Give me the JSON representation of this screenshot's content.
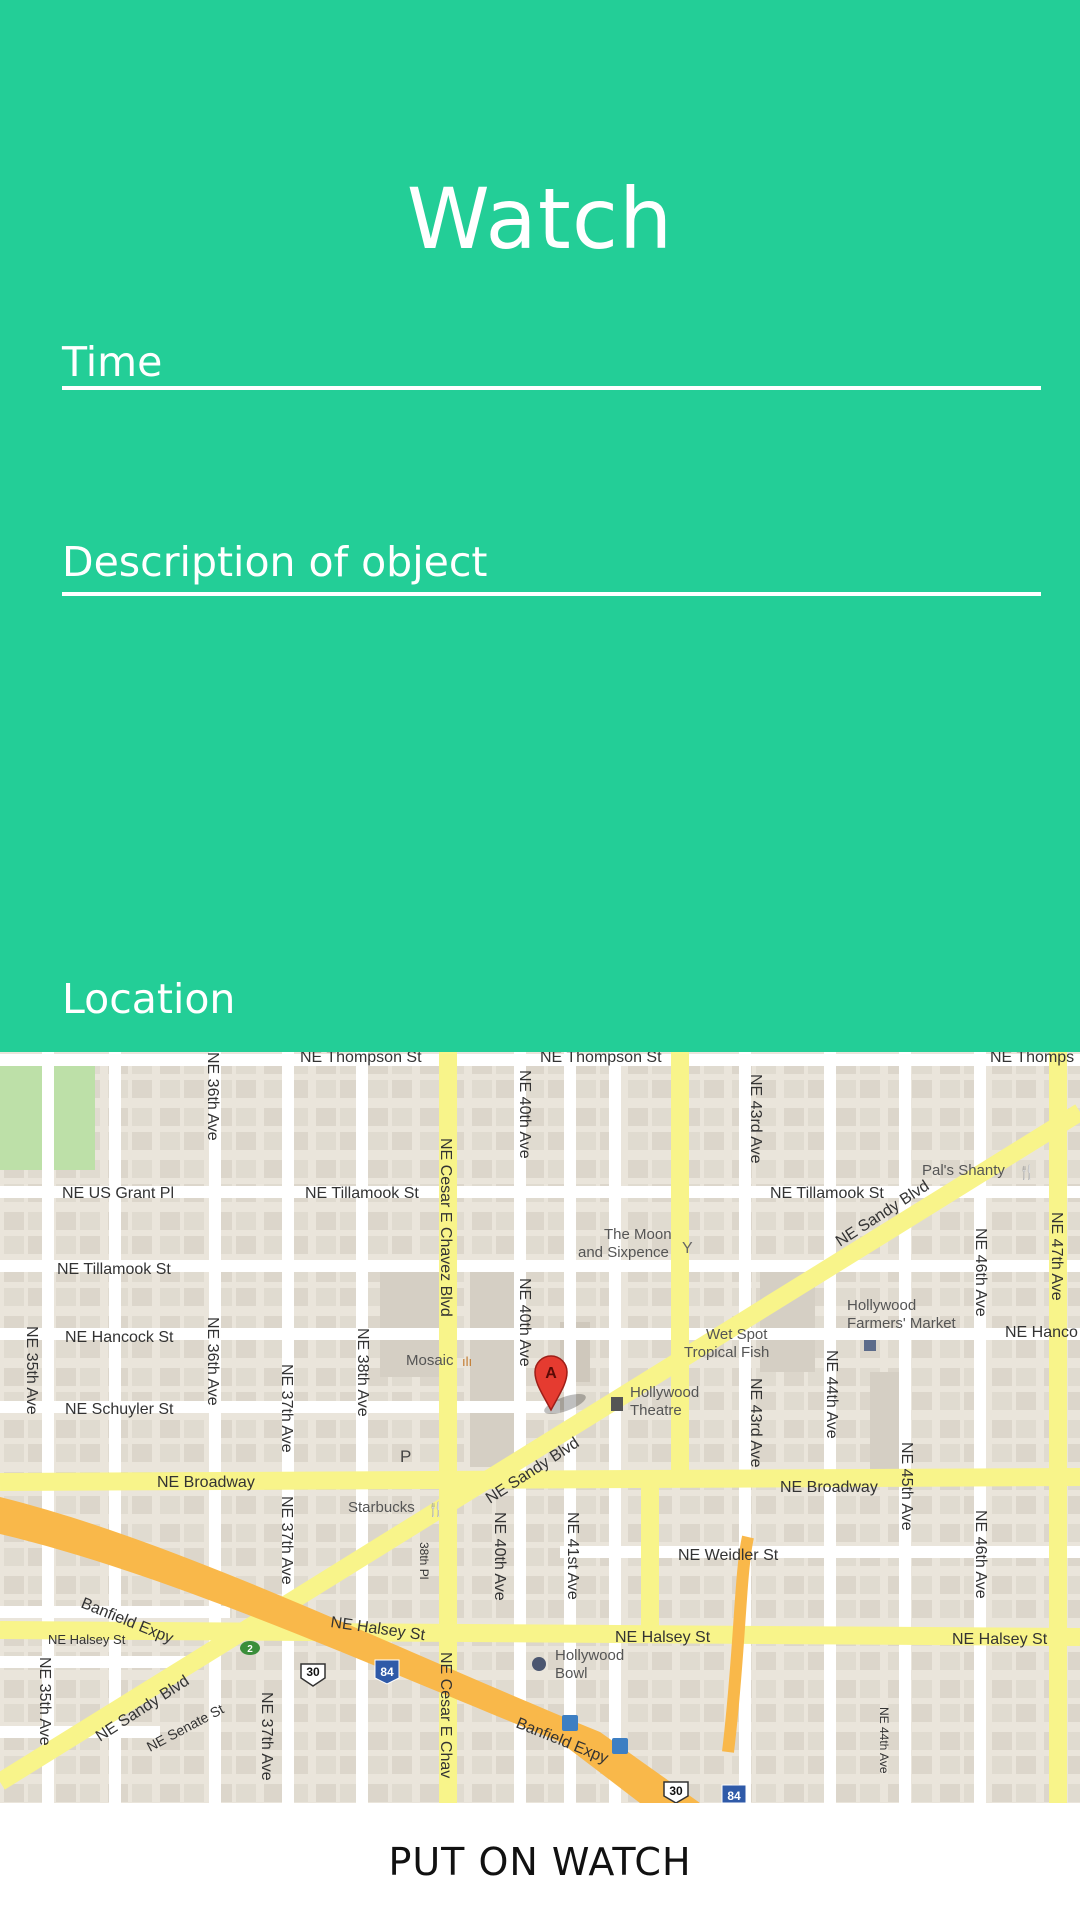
{
  "header": {
    "title": "Watch"
  },
  "fields": {
    "time_label": "Time",
    "description_label": "Description of object",
    "location_label": "Location"
  },
  "map": {
    "streets": {
      "thompson1": "NE Thompson St",
      "thompson2": "NE Thompson St",
      "thompson3": "NE Thomps",
      "us_grant": "NE US Grant Pl",
      "tillamook1": "NE Tillamook St",
      "tillamook2": "NE Tillamook St",
      "tillamook3": "NE Tillamook St",
      "hancock1": "NE Hancock St",
      "hancock2": "NE Hanco",
      "schuyler": "NE Schuyler St",
      "broadway1": "NE Broadway",
      "broadway2": "NE Broadway",
      "weidler": "NE Weidler St",
      "halsey1": "NE Halsey St",
      "halsey2": "NE Halsey St",
      "halsey3": "NE Halsey St",
      "halsey4": "NE Halsey St",
      "senate": "NE Senate St",
      "sandy1": "NE Sandy Blvd",
      "sandy2": "NE Sandy Blvd",
      "sandy3": "NE Sandy Blvd",
      "banfield1": "Banfield Expy",
      "banfield2": "Banfield Expy",
      "ave35a": "NE 35th Ave",
      "ave35b": "NE 35th Ave",
      "ave36a": "NE 36th Ave",
      "ave36b": "NE 36th Ave",
      "ave37a": "NE 37th Ave",
      "ave37b": "NE 37th Ave",
      "ave37c": "NE 37th Ave",
      "ave38": "NE 38th Ave",
      "pl38": "38th Pl",
      "chavez1": "NE Cesar E Chavez Blvd",
      "chavez2": "NE Cesar E Chav",
      "ave40a": "NE 40th Ave",
      "ave40b": "NE 40th Ave",
      "ave40c": "NE 40th Ave",
      "ave41": "NE 41st Ave",
      "ave43a": "NE 43rd Ave",
      "ave43b": "NE 43rd Ave",
      "ave44a": "NE 44th Ave",
      "ave44b": "NE 44th Ave",
      "ave45": "NE 45th Ave",
      "ave46a": "NE 46th Ave",
      "ave46b": "NE 46th Ave",
      "ave47": "NE 47th Ave"
    },
    "pois": {
      "pals_shanty": "Pal's Shanty",
      "moon1": "The Moon",
      "moon2": "and Sixpence",
      "farmers1": "Hollywood",
      "farmers2": "Farmers' Market",
      "wetspot1": "Wet Spot",
      "wetspot2": "Tropical Fish",
      "mosaic": "Mosaic",
      "theatre1": "Hollywood",
      "theatre2": "Theatre",
      "starbucks": "Starbucks",
      "bowl1": "Hollywood",
      "bowl2": "Bowl"
    },
    "marker_label": "A",
    "shields": {
      "us30a": "30",
      "us30b": "30",
      "i84a": "84",
      "i84b": "84",
      "exit2": "2"
    },
    "colors": {
      "background": "#EAE5DB",
      "road": "#FFFFFF",
      "arterial": "#F8F48A",
      "highway": "#F9B84A",
      "park": "#BDE0A8",
      "marker": "#E53B30"
    }
  },
  "actions": {
    "put_on_watch": "PUT ON WATCH"
  },
  "colors": {
    "accent": "#23CE97"
  }
}
